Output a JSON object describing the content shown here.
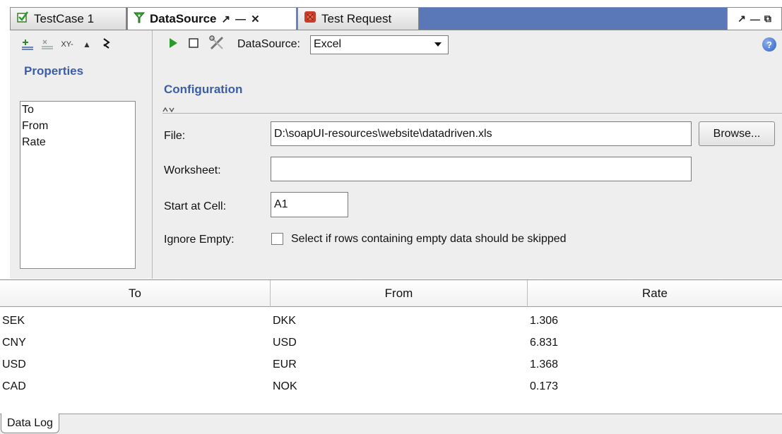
{
  "tabs": [
    {
      "label": "TestCase 1",
      "icon": "testcase-check-icon"
    },
    {
      "label": "DataSource",
      "icon": "datasource-funnel-icon",
      "controls": [
        "↗",
        "—",
        "✕"
      ]
    },
    {
      "label": "Test Request",
      "icon": "soap-request-icon"
    }
  ],
  "window_controls": [
    "↗",
    "—",
    "⧉"
  ],
  "left_panel": {
    "toolbar_icons": [
      "add-property-icon",
      "remove-property-icon",
      "xy-icon",
      "move-up-icon",
      "collapse-arrow-icon"
    ],
    "toolbar_text": {
      "add": "+",
      "remove": "×",
      "xy": "XY-",
      "up": "▲",
      "arrows": "›"
    },
    "title": "Properties",
    "properties": [
      "To",
      "From",
      "Rate"
    ]
  },
  "config": {
    "toolbar": {
      "run_icon": "play-icon",
      "stop_icon": "stop-icon",
      "tools_icon": "scissors-wrench-icon",
      "datasource_label": "DataSource:",
      "datasource_value": "Excel"
    },
    "title": "Configuration",
    "file_label": "File:",
    "file_value": "D:\\soapUI-resources\\website\\datadriven.xls",
    "browse_label": "Browse...",
    "worksheet_label": "Worksheet:",
    "worksheet_value": "",
    "start_cell_label": "Start at Cell:",
    "start_cell_value": "A1",
    "ignore_empty_label": "Ignore Empty:",
    "ignore_empty_text": "Select if rows containing empty data should be skipped",
    "ignore_empty_checked": false
  },
  "table": {
    "columns": [
      "To",
      "From",
      "Rate"
    ],
    "rows": [
      [
        "SEK",
        "DKK",
        "1.306"
      ],
      [
        "CNY",
        "USD",
        "6.831"
      ],
      [
        "USD",
        "EUR",
        "1.368"
      ],
      [
        "CAD",
        "NOK",
        "0.173"
      ]
    ]
  },
  "bottom_tab": "Data Log",
  "colors": {
    "tabstrip_blue": "#5a78b8",
    "title_blue": "#3b5ea8",
    "panel_bg": "#eeeeee",
    "run_green": "#2a9a2a",
    "request_red": "#c83a2a"
  }
}
